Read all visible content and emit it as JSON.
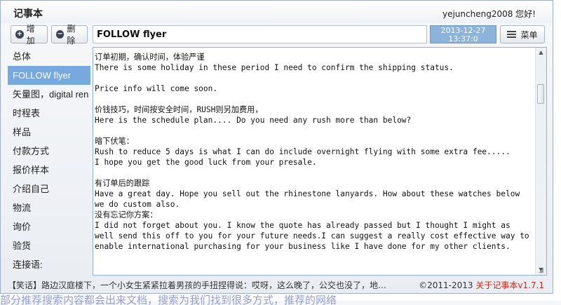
{
  "window": {
    "title": "记事本",
    "user_greeting": "yejuncheng2008 您好!"
  },
  "toolbar": {
    "add_label": "增加",
    "delete_label": "删除",
    "note_title_value": "FOLLOW flyer",
    "date": "2013-12-27",
    "time": "13:37:0",
    "menu_label": "菜单"
  },
  "sidebar": {
    "items": [
      {
        "label": "总体",
        "active": false
      },
      {
        "label": "FOLLOW flyer",
        "active": true
      },
      {
        "label": "矢量图，digital ren",
        "active": false
      },
      {
        "label": "时程表",
        "active": false
      },
      {
        "label": "样品",
        "active": false
      },
      {
        "label": "付款方式",
        "active": false
      },
      {
        "label": "报价样本",
        "active": false
      },
      {
        "label": "介绍自己",
        "active": false
      },
      {
        "label": "物流",
        "active": false
      },
      {
        "label": "询价",
        "active": false
      },
      {
        "label": "验货",
        "active": false
      },
      {
        "label": "连接语:",
        "active": false
      }
    ]
  },
  "content": {
    "text": "订单初期，确认时间，体验严谨\nThere is some holiday in these period I need to confirm the shipping status.\n\nPrice info will come soon.\n\n价钱技巧，时间按安全时间，RUSH则另加费用，\nHere is the schedule plan.... Do you need any rush more than below?\n\n暗下伏笔：\nRush to reduce 5 days is what I can do include overnight flying with some extra fee.....\nI hope you get the good luck from your presale.\n\n有订单后的跟踪\nHave a great day. Hope you sell out the rhinestone lanyards. How about these watches below we do custom also.\n没有忘记你方案：\nI did not forget about you. I know the quote has already passed but I thought I might as well send this off to you for your future needs.I can suggest a really cost effective way to enable international purchasing for your business like I have done for my other clients."
  },
  "status": {
    "joke": "【笑话】路边汉庭楼下，一个小女生紧紧拉着男孩的手扭捏得说：哎呀，这么晚了，公交也没了，地…",
    "copyright": "©2011-2013",
    "about_link": "关于记事本v1.7.1"
  },
  "background": {
    "peek_text": "部分推荐搜索内容都会出来文档，搜索为我们找到很多方式，推荐的网络"
  },
  "colors": {
    "accent_blue": "#78a9de",
    "datetime_bg": "#8cb4da",
    "link_red": "#d2281e"
  },
  "icons": {
    "add": "plus-circle-icon",
    "delete": "minus-circle-icon",
    "menu": "menu-lines-icon"
  }
}
